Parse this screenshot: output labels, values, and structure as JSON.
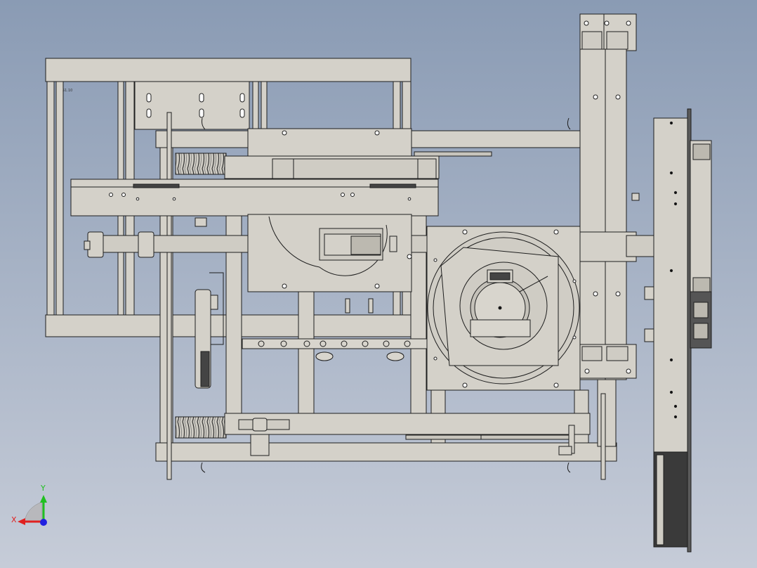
{
  "viewport": {
    "background_top": "#8a9bb4",
    "background_bottom": "#c6ccd8",
    "part_fill": "#d4d1c9",
    "part_fill_dark": "#bcb9b0",
    "edge_color": "#1e1e1e"
  },
  "model": {
    "small_annotation": "51.10"
  },
  "triad": {
    "x_label": "X",
    "y_label": "Y",
    "x_color": "#e02020",
    "y_color": "#20c020",
    "z_color": "#2020e0"
  }
}
